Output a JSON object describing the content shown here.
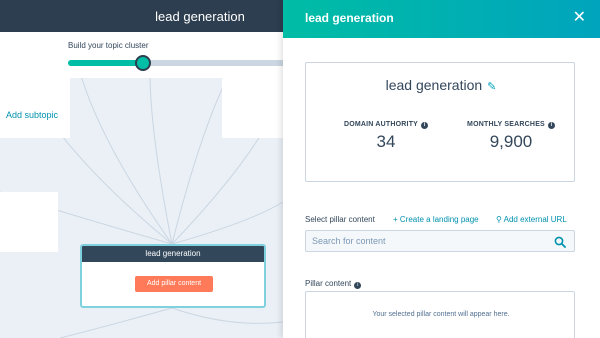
{
  "app": {
    "title": "lead generation"
  },
  "canvas": {
    "cluster_label": "Build your topic cluster",
    "progress_fraction": 0.34,
    "add_subtopic": "Add subtopic",
    "pillar_card": {
      "title": "lead generation",
      "button": "Add pillar content"
    }
  },
  "panel": {
    "title": "lead generation",
    "close_icon": "close-icon",
    "keyword": "lead generation",
    "metrics": [
      {
        "label": "DOMAIN AUTHORITY",
        "value": "34"
      },
      {
        "label": "MONTHLY SEARCHES",
        "value": "9,900"
      }
    ],
    "select_pillar_label": "Select pillar content",
    "create_landing_page": "Create a landing page",
    "add_external_url": "Add external URL",
    "search_placeholder": "Search for content",
    "pillar_content_label": "Pillar content",
    "pillar_empty": "Your selected pillar content will appear here."
  },
  "colors": {
    "header_start": "#00bda5",
    "header_end": "#00a4bd",
    "topbar": "#2d3e50",
    "accent_orange": "#ff7a59",
    "link": "#0091ae"
  }
}
